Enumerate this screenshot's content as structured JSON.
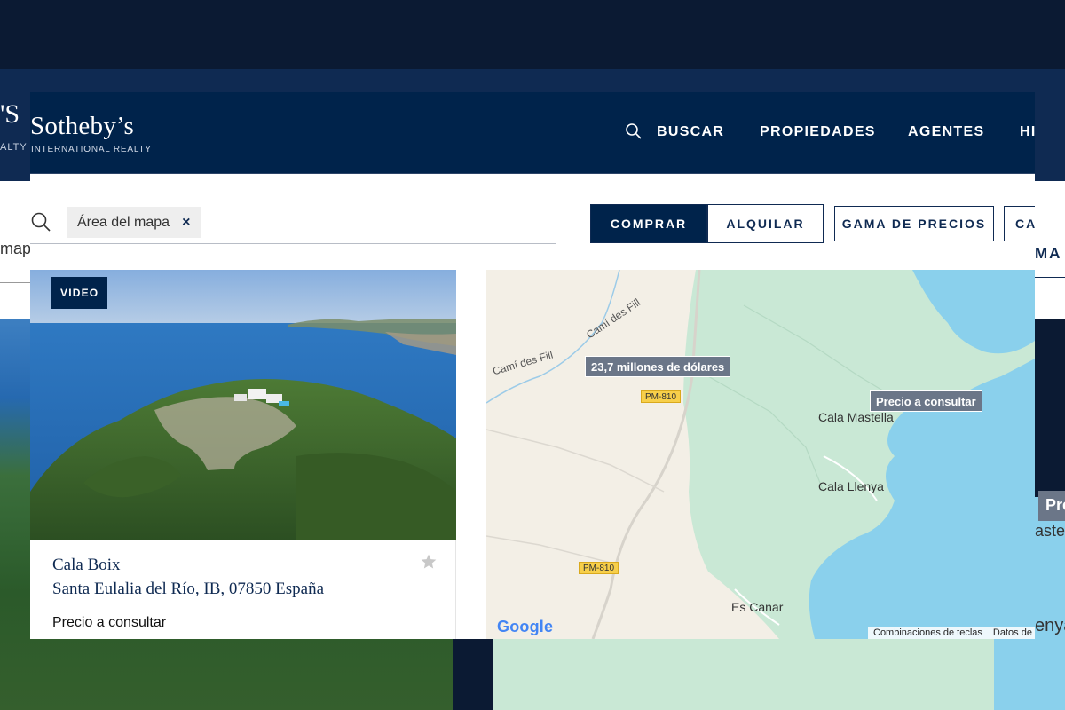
{
  "brand": {
    "name": "Sotheby’s",
    "subtitle": "INTERNATIONAL REALTY",
    "ghost_name": "'S",
    "ghost_subtitle": "ALTY"
  },
  "nav": {
    "search_label": "BUSCAR",
    "properties_label": "PROPIEDADES",
    "agents_label": "AGENTES",
    "more_label": "HI"
  },
  "search": {
    "chip_label": "Área del mapa",
    "chip_close": "×",
    "ghost_chip_text": "map"
  },
  "filters": {
    "buy_label": "COMPRAR",
    "rent_label": "ALQUILAR",
    "price_label": "GAMA DE PRECIOS",
    "more_label": "CA",
    "ghost_more_label": "MA"
  },
  "listing": {
    "badge": "VIDEO",
    "title": "Cala Boix",
    "address": "Santa Eulalia del Río, IB, 07850 España",
    "price": "Precio a consultar"
  },
  "map": {
    "price_tags": [
      "23,7 millones de dólares",
      "Precio a consultar"
    ],
    "places": [
      "Cala Mastella",
      "Cala Llenya",
      "Es Canar"
    ],
    "roads": [
      "Camí des Fill",
      "Camí des Fill"
    ],
    "road_shields": [
      "PM-810",
      "PM-810"
    ],
    "google": "Google",
    "attribution": [
      "Combinaciones de teclas",
      "Datos de"
    ],
    "ghost_tag": "Pre",
    "ghost_places": [
      "aste",
      "enya"
    ]
  },
  "colors": {
    "navy": "#00234b",
    "page_dark": "#0b1a33",
    "map_land": "#f3efe6",
    "map_green": "#c9e8d5",
    "map_water": "#8ad0ec",
    "price_tag": "#6b7688"
  }
}
